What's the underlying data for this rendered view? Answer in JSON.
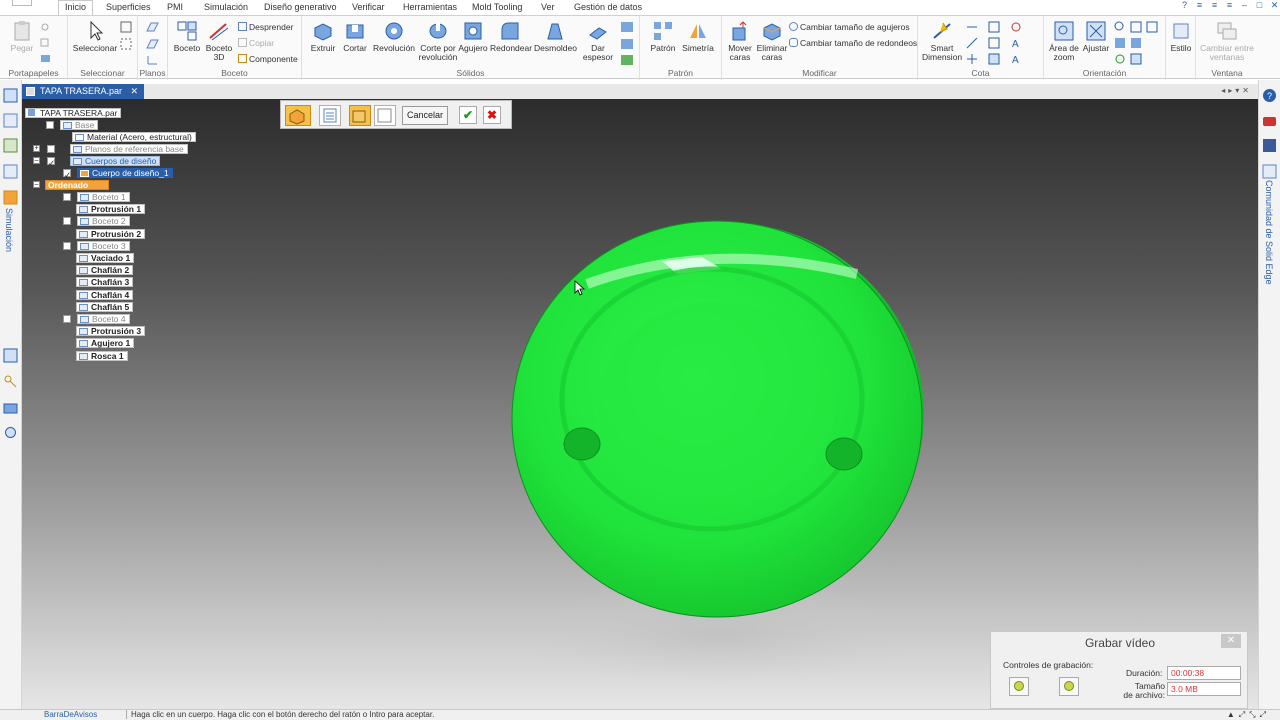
{
  "menu": {
    "tabs": [
      "Inicio",
      "Superficies",
      "PMI",
      "Simulación",
      "Diseño generativo",
      "Verificar",
      "Herramientas",
      "Mold Tooling",
      "Ver",
      "Gestión de datos"
    ],
    "active": "Inicio"
  },
  "ribbon": {
    "portapapeles": {
      "pegar": "Pegar",
      "label": "Portapapeles"
    },
    "seleccionar": {
      "btn": "Seleccionar",
      "label": "Seleccionar"
    },
    "planos": {
      "label": "Planos"
    },
    "boceto": {
      "boceto": "Boceto",
      "boceto3d": "Boceto 3D",
      "desprender": "Desprender",
      "copiar": "Copiar",
      "componente": "Componente",
      "label": "Boceto"
    },
    "solidos": {
      "extruir": "Extruir",
      "cortar": "Cortar",
      "revolucion": "Revolución",
      "corte_revolucion": "Corte por revolución",
      "agujero": "Agujero",
      "redondear": "Redondear",
      "desmoldeo": "Desmoldeo",
      "dar_espesor": "Dar espesor",
      "label": "Sólidos"
    },
    "patron": {
      "patron": "Patrón",
      "simetria": "Simetría",
      "label": "Patrón"
    },
    "modificar": {
      "mover": "Mover caras",
      "eliminar": "Eliminar caras",
      "cambiar_agujeros": "Cambiar tamaño de agujeros",
      "cambiar_redondeos": "Cambiar tamaño de redondeos",
      "label": "Modificar"
    },
    "cota": {
      "smart": "Smart Dimension",
      "label": "Cota"
    },
    "orientacion": {
      "area_zoom": "Área de zoom",
      "ajustar": "Ajustar",
      "label": "Orientación"
    },
    "estilo": {
      "estilo": "Estilo"
    },
    "ventana": {
      "cambiar": "Cambiar entre ventanas",
      "label": "Ventana"
    }
  },
  "document": {
    "tab": "TAPA TRASERA.par"
  },
  "tree": {
    "root": "TAPA TRASERA.par",
    "base": "Base",
    "material": "Material (Acero, estructural)",
    "planos": "Planos de referencia base",
    "cuerpos": "Cuerpos de diseño",
    "cuerpo1": "Cuerpo de diseño_1",
    "ordenado": "Ordenado",
    "items": [
      {
        "label": "Boceto 1",
        "gray": true
      },
      {
        "label": "Protrusión 1"
      },
      {
        "label": "Boceto 2",
        "gray": true
      },
      {
        "label": "Protrusión 2"
      },
      {
        "label": "Boceto 3",
        "gray": true
      },
      {
        "label": "Vaciado 1"
      },
      {
        "label": "Chaflán 2"
      },
      {
        "label": "Chaflán 3"
      },
      {
        "label": "Chaflán 4"
      },
      {
        "label": "Chaflán 5"
      },
      {
        "label": "Boceto 4",
        "gray": true
      },
      {
        "label": "Protrusión 3"
      },
      {
        "label": "Agujero 1"
      },
      {
        "label": "Rosca 1"
      }
    ]
  },
  "commandbar": {
    "cancel": "Cancelar"
  },
  "side": {
    "left_vertical": "Simulación",
    "right_vertical": "Comunidad de Solid Edge"
  },
  "record": {
    "title": "Grabar vídeo",
    "controls_label": "Controles de grabación:",
    "duration_label": "Duración:",
    "duration": "00:00:38",
    "size_label": "Tamaño de archivo:",
    "size": "3.0 MB"
  },
  "status": {
    "left": "BarraDeAvisos",
    "prompt": "Haga clic en un cuerpo. Haga clic con el botón derecho del ratón o Intro para aceptar."
  },
  "colors": {
    "accent": "#2a5ea8",
    "part": "#1ee63a",
    "tree_highlight": "#f3a33b"
  }
}
